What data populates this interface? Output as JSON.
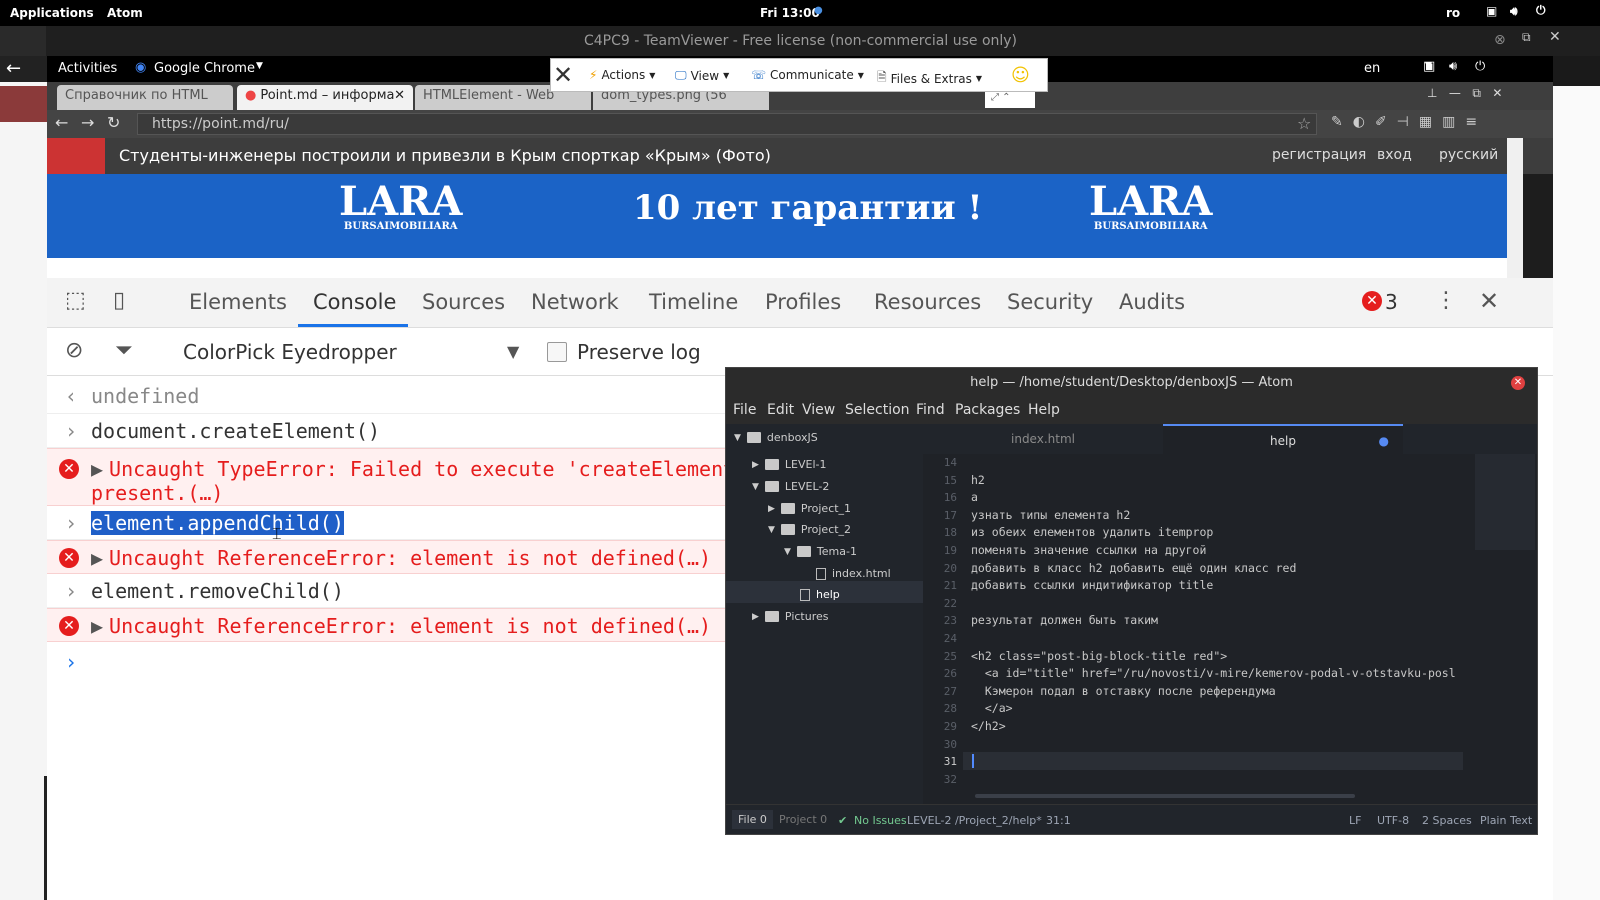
{
  "topbar": {
    "applications": "Applications",
    "app": "Atom",
    "clock": "Fri 13:00",
    "lang": "ro"
  },
  "teamviewer": {
    "title": "C4PC9 - TeamViewer - Free license (non-commercial use only)",
    "toolbar": {
      "actions": "Actions",
      "view": "View",
      "communicate": "Communicate",
      "files": "Files & Extras"
    }
  },
  "remote_bar": {
    "activities": "Activities",
    "browser": "Google Chrome",
    "lang": "en"
  },
  "chrome": {
    "tabs": [
      {
        "label": "Справочник по HTML"
      },
      {
        "label": "Point.md – информа"
      },
      {
        "label": "HTMLElement - Web"
      },
      {
        "label": "dom_types.png (56"
      }
    ],
    "url": "https://point.md/ru/"
  },
  "page": {
    "headline": "Студенты-инженеры построили и привезли в Крым спорткар «Крым» (Фото)",
    "links": [
      "регистрация",
      "вход",
      "русский"
    ],
    "banner_text": "10 лет гарантии !",
    "logo_big": "LARA",
    "logo_small": "BURSAIMOBILIARA"
  },
  "devtools": {
    "tabs": [
      "Elements",
      "Console",
      "Sources",
      "Network",
      "Timeline",
      "Profiles",
      "Resources",
      "Security",
      "Audits"
    ],
    "error_count": "3",
    "context": "ColorPick Eyedropper",
    "preserve_log": "Preserve log",
    "console": [
      {
        "type": "result",
        "text": "undefined"
      },
      {
        "type": "input",
        "text": "document.createElement()"
      },
      {
        "type": "error",
        "text": "Uncaught TypeError: Failed to execute 'createElement'",
        "text2": "present.(…)"
      },
      {
        "type": "input",
        "text": "element.appendChild()"
      },
      {
        "type": "error",
        "text": "Uncaught ReferenceError: element is not defined(…)"
      },
      {
        "type": "input",
        "text": "element.removeChild()"
      },
      {
        "type": "error",
        "text": "Uncaught ReferenceError: element is not defined(…)"
      }
    ]
  },
  "atom": {
    "title": "help — /home/student/Desktop/denboxJS — Atom",
    "menu": [
      "File",
      "Edit",
      "View",
      "Selection",
      "Find",
      "Packages",
      "Help"
    ],
    "tree": {
      "root": "denboxJS",
      "items": [
        "LEVEl-1",
        "LEVEL-2",
        "Project_1",
        "Project_2",
        "Tema-1",
        "index.html",
        "help",
        "Pictures"
      ]
    },
    "tabs": [
      "index.html",
      "help"
    ],
    "gutter": [
      "14",
      "15",
      "16",
      "17",
      "18",
      "19",
      "20",
      "21",
      "22",
      "23",
      "24",
      "25",
      "26",
      "27",
      "28",
      "29",
      "30",
      "31",
      "32"
    ],
    "lines": [
      "",
      "h2",
      "a",
      "узнать типы елемента h2",
      "из обеих елементов удалить itemprop",
      "поменять значение ссылки на другой",
      "добавить в класс h2 добавить ещё один класс red",
      "добавить ссылки индитификатор title",
      "",
      "результат должен быть таким",
      "",
      "<h2 class=\"post-big-block-title red\">",
      "  <a id=\"title\" href=\"/ru/novosti/v-mire/kemerov-podal-v-otstavku-posl",
      "  Кэмерон подал в отставку после референдума",
      "  </a>",
      "</h2>",
      "",
      "",
      ""
    ],
    "status": {
      "file": "File 0",
      "project": "Project 0",
      "issues": "No Issues",
      "path": "LEVEL-2 /Project_2/help*",
      "cursor": "31:1",
      "eol": "LF",
      "encoding": "UTF-8",
      "indent": "2 Spaces",
      "grammar": "Plain Text"
    }
  }
}
